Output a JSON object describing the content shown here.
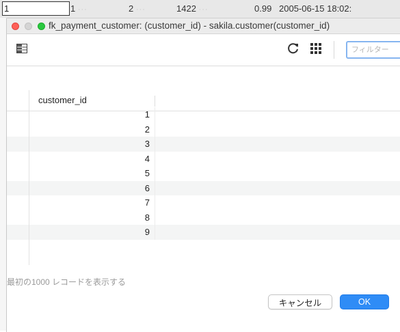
{
  "background_row": {
    "edit_value": "1",
    "cells": [
      "1",
      "2",
      "1422",
      "0.99",
      "2005-06-15 18:02:"
    ],
    "ellipsis": "···"
  },
  "window": {
    "title": "fk_payment_customer: (customer_id) - sakila.customer(customer_id)"
  },
  "toolbar": {
    "columns_icon": "columns-icon",
    "refresh_icon": "refresh-icon",
    "grid_icon": "grid-icon",
    "filter_placeholder": "フィルター"
  },
  "table": {
    "columns": [
      "customer_id"
    ],
    "rows": [
      "1",
      "2",
      "3",
      "4",
      "5",
      "6",
      "7",
      "8",
      "9"
    ]
  },
  "footer": {
    "note": "最初の1000 レコードを表示する",
    "cancel_label": "キャンセル",
    "ok_label": "OK"
  },
  "colors": {
    "accent": "#2f8cf6",
    "close": "#fe5f57",
    "maximize": "#2ac840",
    "minimize_disabled": "#d4d4d4"
  }
}
